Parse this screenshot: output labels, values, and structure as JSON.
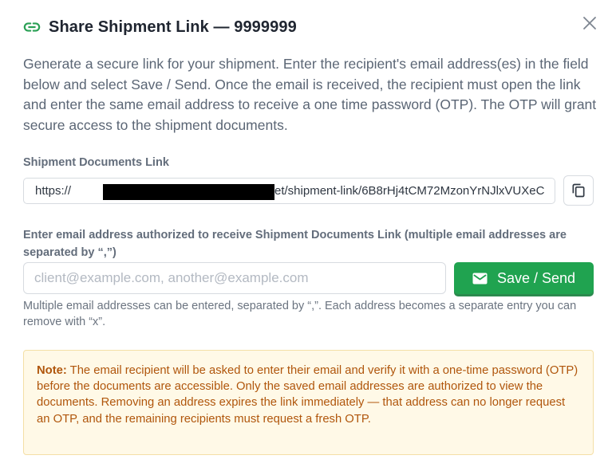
{
  "dialog": {
    "title": "Share Shipment Link — 9999999",
    "icons": {
      "title": "link-icon",
      "close": "close-icon",
      "copy": "copy-icon",
      "send": "mail-icon"
    },
    "intro": "Generate a secure link for your shipment. Enter the recipient's email address(es) in the field below and select Save / Send. Once the email is received, the recipient must open the link and enter the same email address to receive a one time password (OTP). The OTP will grant secure access to the shipment documents."
  },
  "link_section": {
    "label": "Shipment Documents Link",
    "prefix": "https://",
    "suffix": "et/shipment-link/6B8rHj4tCM72MzonYrNJlxVUXeC"
  },
  "email_section": {
    "label": "Enter email address authorized to receive Shipment Documents Link (multiple email addresses are separated by “,”)",
    "value": "",
    "placeholder": "client@example.com, another@example.com",
    "send_label": "Save / Send",
    "helper": "Multiple email addresses can be entered, separated by “,”. Each address becomes a separate entry you can remove with “x”."
  },
  "note": {
    "heading": "Note:",
    "text": " The email recipient will be asked to enter their email and verify it with a one-time password (OTP) before the documents are accessible. Only the saved email addresses are authorized to view the documents. Removing an address expires the link immediately — that address can no longer request an OTP, and the remaining recipients must request a fresh OTP."
  },
  "colors": {
    "accent_green": "#20a350",
    "note_text": "#b0560c",
    "note_bg": "#fff9e7"
  }
}
